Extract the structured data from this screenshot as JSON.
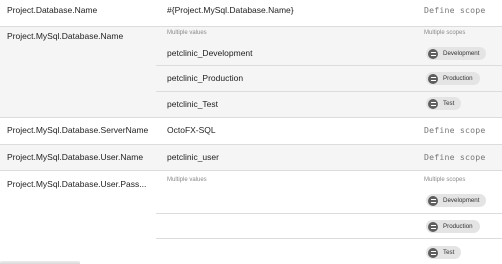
{
  "define_scope_label": "Define scope",
  "multiple_values_label": "Multiple values",
  "multiple_scopes_label": "Multiple scopes",
  "variables": [
    {
      "name": "Project.Database.Name",
      "value": "#{Project.MySql.Database.Name}"
    },
    {
      "name": "Project.MySql.Database.Name",
      "values": [
        {
          "value": "petclinic_Development",
          "scope": "Development"
        },
        {
          "value": "petclinic_Production",
          "scope": "Production"
        },
        {
          "value": "petclinic_Test",
          "scope": "Test"
        }
      ]
    },
    {
      "name": "Project.MySql.Database.ServerName",
      "value": "OctoFX-SQL"
    },
    {
      "name": "Project.MySql.Database.User.Name",
      "value": "petclinic_user"
    },
    {
      "name": "Project.MySql.Database.User.Pass...",
      "values": [
        {
          "value": "",
          "scope": "Development"
        },
        {
          "value": "",
          "scope": "Production"
        },
        {
          "value": "",
          "scope": "Test"
        }
      ]
    }
  ]
}
